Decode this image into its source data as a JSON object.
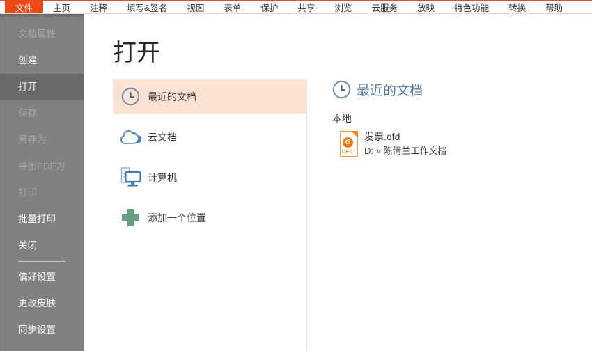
{
  "menu": {
    "items": [
      {
        "label": "文件"
      },
      {
        "label": "主页"
      },
      {
        "label": "注释"
      },
      {
        "label": "填写&签名"
      },
      {
        "label": "视图"
      },
      {
        "label": "表单"
      },
      {
        "label": "保护"
      },
      {
        "label": "共享"
      },
      {
        "label": "浏览"
      },
      {
        "label": "云服务"
      },
      {
        "label": "放映"
      },
      {
        "label": "特色功能"
      },
      {
        "label": "转换"
      },
      {
        "label": "帮助"
      }
    ]
  },
  "sidebar": {
    "items": [
      {
        "label": "文档属性",
        "state": "disabled"
      },
      {
        "label": "创建",
        "state": "normal"
      },
      {
        "label": "打开",
        "state": "selected"
      },
      {
        "label": "保存",
        "state": "disabled"
      },
      {
        "label": "另存为",
        "state": "disabled"
      },
      {
        "label": "导出PDF为",
        "state": "disabled"
      },
      {
        "label": "打印",
        "state": "disabled"
      },
      {
        "label": "批量打印",
        "state": "normal"
      },
      {
        "label": "关闭",
        "state": "normal"
      }
    ],
    "footer_items": [
      {
        "label": "偏好设置"
      },
      {
        "label": "更改皮肤"
      },
      {
        "label": "同步设置"
      }
    ]
  },
  "page": {
    "title": "打开"
  },
  "open_nav": {
    "items": [
      {
        "label": "最近的文档",
        "icon": "clock-icon",
        "selected": true
      },
      {
        "label": "云文档",
        "icon": "cloud-icon",
        "selected": false
      },
      {
        "label": "计算机",
        "icon": "computer-icon",
        "selected": false
      },
      {
        "label": "添加一个位置",
        "icon": "plus-icon",
        "selected": false
      }
    ]
  },
  "recent_panel": {
    "title": "最近的文档",
    "header_icon": "clock-icon",
    "group_label": "本地",
    "files": [
      {
        "name": "发票.ofd",
        "path": "D: » 陈倩兰工作文档",
        "icon": "ofd-file-icon",
        "logo_letter": "G",
        "type_badge": "OFD"
      }
    ]
  },
  "colors": {
    "accent_orange": "#ea4a17",
    "selection_peach": "#fbe2d3",
    "sidebar_gray": "#818181",
    "sidebar_selected_gray": "#696969",
    "icon_blue": "#4d7fae",
    "plus_green": "#68a17e",
    "recent_title_blue": "#57799e",
    "ofd_icon_orange": "#ef8420"
  }
}
